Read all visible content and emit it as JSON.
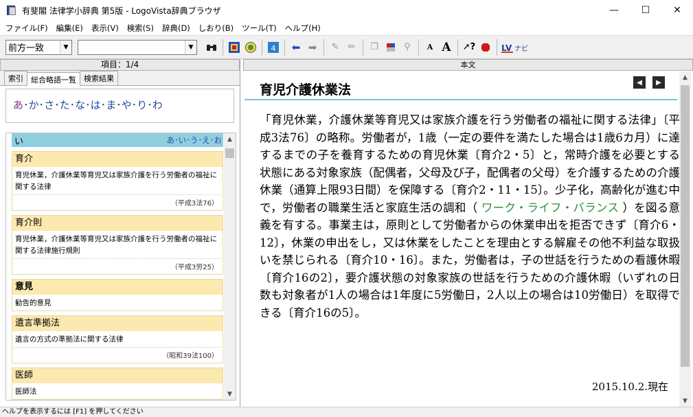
{
  "window": {
    "title": "有斐閣 法律学小辞典 第5版 - LogoVista辞典ブラウザ"
  },
  "menu": [
    "ファイル(F)",
    "編集(E)",
    "表示(V)",
    "検索(S)",
    "辞典(D)",
    "しおり(B)",
    "ツール(T)",
    "ヘルプ(H)"
  ],
  "toolbar": {
    "search_mode": "前方一致",
    "search_value": ""
  },
  "left": {
    "header": "項目：1/4",
    "tabs": [
      "索引",
      "総合略語一覧",
      "検索結果"
    ],
    "kana": [
      "あ",
      "か",
      "さ",
      "た",
      "な",
      "は",
      "ま",
      "や",
      "り",
      "わ"
    ],
    "section": {
      "title": "い",
      "nav": "あ･い･う･え･お"
    },
    "entries": [
      {
        "head": "育介",
        "body": "育児休業，介護休業等育児又は家族介護を行う労働者の福祉に関する法律",
        "source": "（平成3法76）"
      },
      {
        "head": "育介則",
        "body": "育児休業，介護休業等育児又は家族介護を行う労働者の福祉に関する法律施行規則",
        "source": "（平成3労25）"
      },
      {
        "head": "意見",
        "body": "勧告的意見",
        "source": ""
      },
      {
        "head": "遺言準拠法",
        "body": "遺言の方式の準拠法に関する法律",
        "source": "（昭和39法100）"
      },
      {
        "head": "医師",
        "body": "医師法",
        "source": ""
      }
    ]
  },
  "right": {
    "header": "本文",
    "title": "育児介護休業法",
    "body_part1": "「育児休業，介護休業等育児又は家族介護を行う労働者の福祉に関する法律」〔平成3法76〕の略称。労働者が，1歳（一定の要件を満たした場合は1歳6カ月）に達するまでの子を養育するための育児休業〔育介2・5〕と，常時介護を必要とする状態にある対象家族（配偶者，父母及び子，配偶者の父母）を介護するための介護休業（通算上限93日間）を保障する〔育介2・11・15〕。少子化，高齢化が進む中で，労働者の職業生活と家庭生活の調和（",
    "body_link": " ワーク・ライフ・バランス ",
    "body_part2": "）を図る意義を有する。事業主は，原則として労働者からの休業申出を拒否できず〔育介6・12〕，休業の申出をし，又は休業をしたことを理由とする解雇その他不利益な取扱いを禁じられる〔育介10・16〕。また，労働者は，子の世話を行うための看護休暇〔育介16の2〕，要介護状態の対象家族の世話を行うための介護休暇（いずれの日数も対象者が1人の場合は1年度に5労働日，2人以上の場合は10労働日）を取得できる〔育介16の5〕。",
    "date": "2015.10.2.現在"
  },
  "status": "ヘルプを表示するには [F1] を押してください"
}
